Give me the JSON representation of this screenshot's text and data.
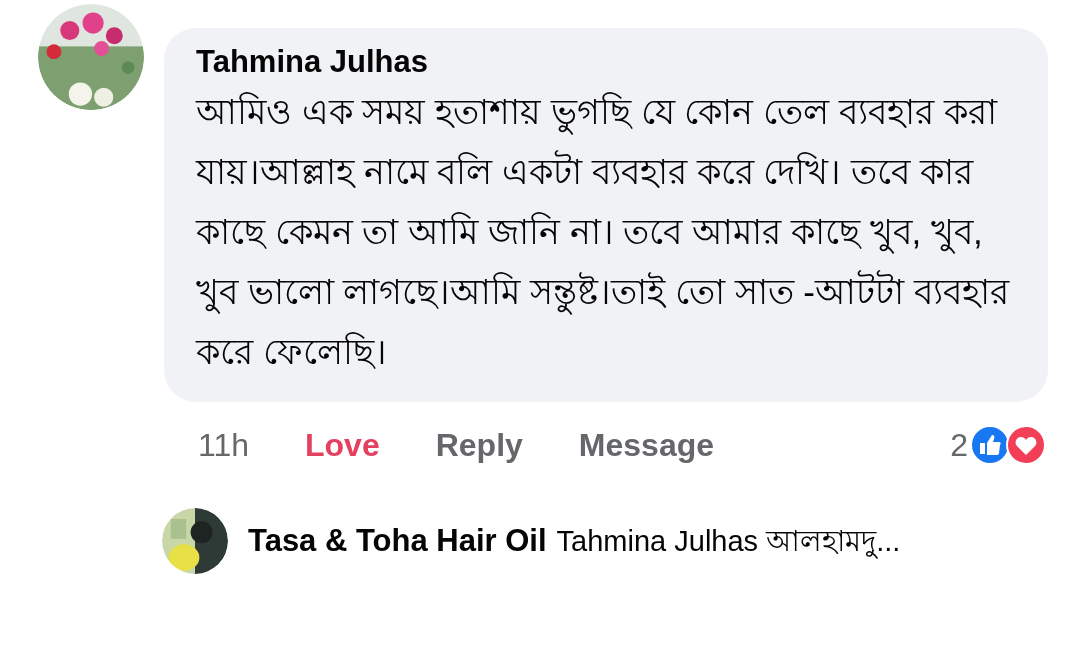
{
  "comment": {
    "author": "Tahmina Julhas",
    "text": "আমিও এক সময় হতাশায় ভুগছি যে কোন তেল ব্যবহার করা যায়।আল্লাহ নামে বলি একটা ব্যবহার করে দেখি। তবে কার কাছে কেমন তা আমি জানি না। তবে আমার কাছে খুব, খুব, খুব ভালো লাগছে।আমি সন্তুষ্ট।তাই তো সাত -আটটা ব্যবহার করে ফেলেছি।",
    "time": "11h",
    "actions": [
      {
        "label": "Love",
        "selected": true
      },
      {
        "label": "Reply",
        "selected": false
      },
      {
        "label": "Message",
        "selected": false
      }
    ],
    "reaction_count": "2"
  },
  "reply": {
    "author": "Tasa & Toha Hair Oil",
    "text": "Tahmina Julhas আলহামদু..."
  }
}
